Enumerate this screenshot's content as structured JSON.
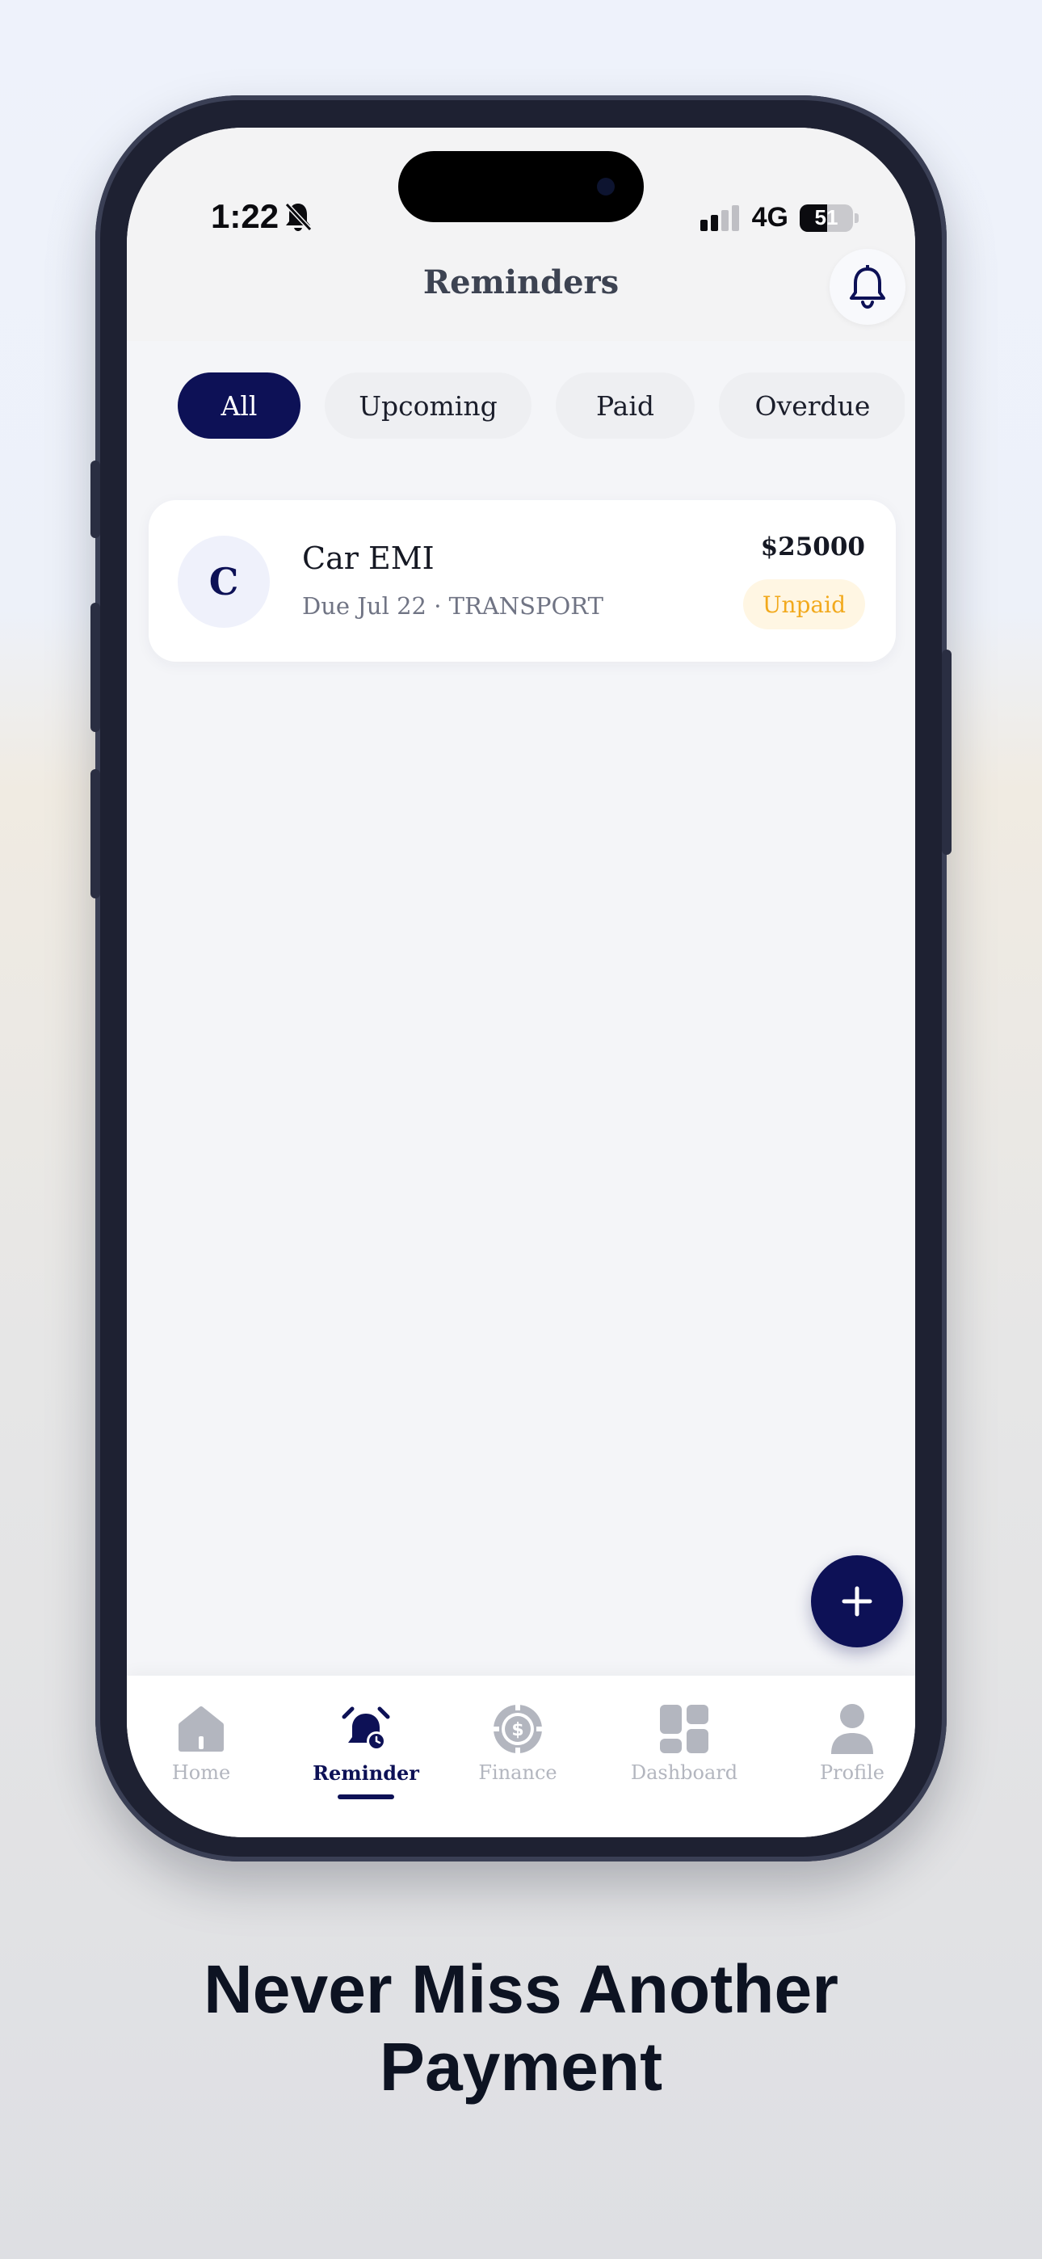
{
  "status_bar": {
    "time": "1:22",
    "network": "4G",
    "battery": "51",
    "battery_fraction": 0.51
  },
  "header": {
    "title": "Reminders"
  },
  "filters": [
    {
      "label": "All",
      "active": true
    },
    {
      "label": "Upcoming",
      "active": false
    },
    {
      "label": "Paid",
      "active": false
    },
    {
      "label": "Overdue",
      "active": false
    }
  ],
  "reminders": [
    {
      "initial": "C",
      "title": "Car EMI",
      "subtitle": "Due Jul 22 · TRANSPORT",
      "amount": "$25000",
      "status": "Unpaid"
    }
  ],
  "fab": {
    "icon": "plus-icon"
  },
  "bottom_nav": [
    {
      "label": "Home",
      "icon": "home-icon",
      "active": false
    },
    {
      "label": "Reminder",
      "icon": "alarm-clock-icon",
      "active": true
    },
    {
      "label": "Finance",
      "icon": "dollar-coin-icon",
      "active": false
    },
    {
      "label": "Dashboard",
      "icon": "grid-icon",
      "active": false
    },
    {
      "label": "Profile",
      "icon": "user-icon",
      "active": false
    }
  ],
  "headline": {
    "line1": "Never Miss Another",
    "line2": "Payment"
  },
  "colors": {
    "primary": "#0d1156",
    "badge_text": "#f2a91c",
    "badge_bg": "#fff6e3",
    "inactive": "#b3b6bf"
  }
}
